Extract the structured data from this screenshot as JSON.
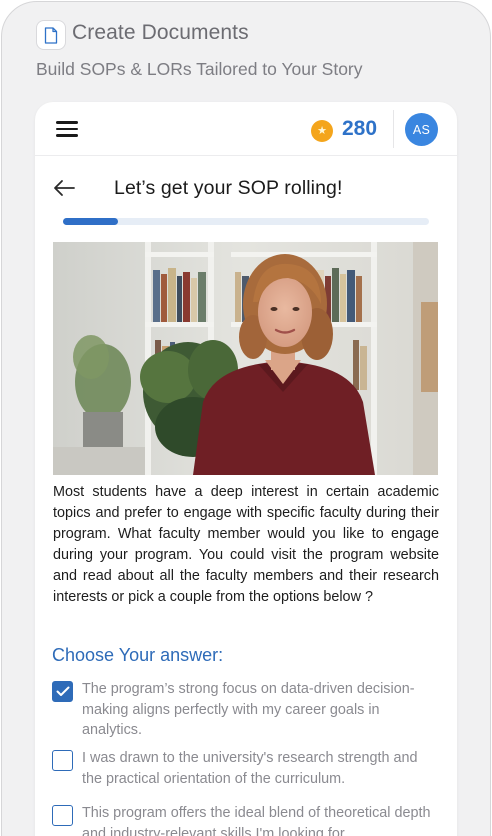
{
  "header": {
    "title": "Create Documents",
    "subtitle": "Build SOPs & LORs Tailored to Your Story"
  },
  "appbar": {
    "coin_count": "280",
    "avatar_initials": "AS",
    "accent_color": "#2e72c8",
    "coin_color": "#f4a51c"
  },
  "page": {
    "title": "Let’s get your SOP rolling!",
    "progress": 0.15
  },
  "question": {
    "text": "Most students have a deep interest in certain academic topics and prefer to engage with specific faculty during their program. What faculty member would you like to engage during your program. You could visit the program website and read about all the faculty members and their research interests or pick a couple from the options below ?"
  },
  "answers": {
    "label": "Choose Your answer:",
    "options": [
      {
        "text": "The program’s strong focus on data-driven decision-making aligns perfectly with my career goals in analytics.",
        "checked": true
      },
      {
        "text": "I was drawn to the university's research strength and the practical orientation of the curriculum.",
        "checked": false
      },
      {
        "text": "This program offers the ideal blend of theoretical depth and industry-relevant skills I'm looking for.",
        "checked": false
      }
    ]
  },
  "icons": {
    "header": "document-icon",
    "menu": "hamburger-menu-icon",
    "coin": "coin-star-icon",
    "back": "arrow-left-icon",
    "check": "checkmark-icon"
  }
}
